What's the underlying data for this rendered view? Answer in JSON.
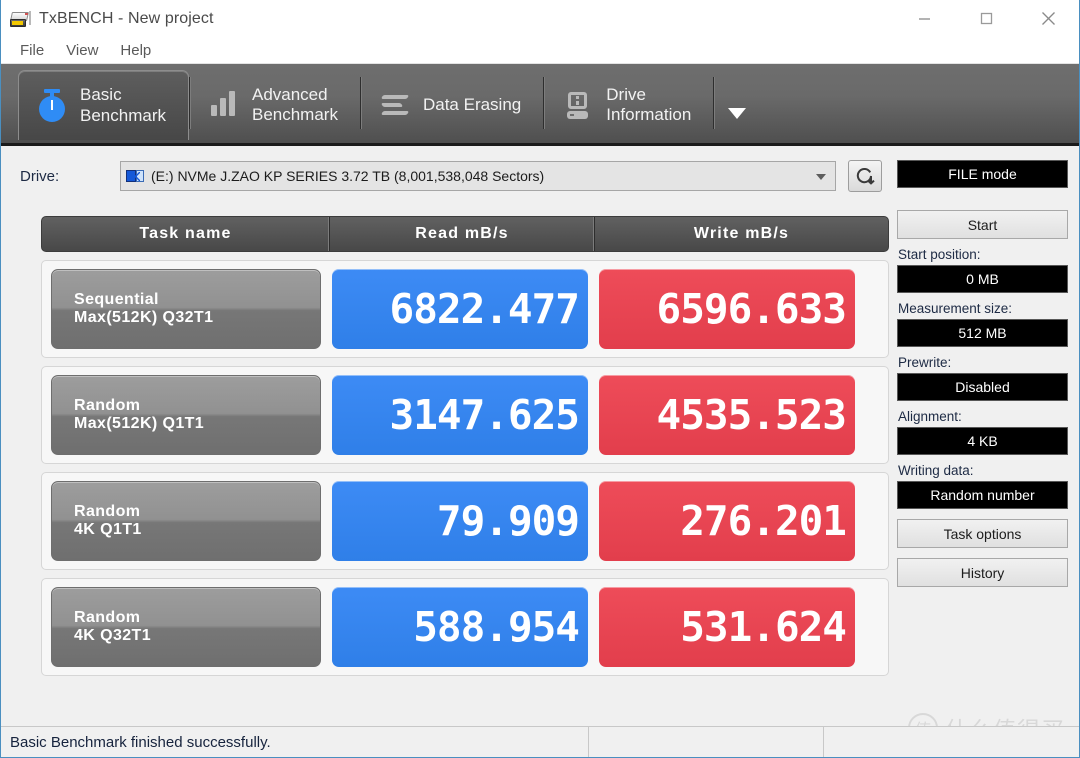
{
  "window": {
    "title": "TxBENCH - New project",
    "icon": "drive-app-icon",
    "controls": {
      "minimize": "minimize-icon",
      "maximize": "maximize-icon",
      "close": "close-icon"
    }
  },
  "menu": {
    "items": [
      "File",
      "View",
      "Help"
    ]
  },
  "tabs": {
    "items": [
      {
        "line1": "Basic",
        "line2": "Benchmark",
        "icon": "stopwatch-icon",
        "active": true
      },
      {
        "line1": "Advanced",
        "line2": "Benchmark",
        "icon": "bar-chart-icon",
        "active": false
      },
      {
        "line1": "Data Erasing",
        "line2": "",
        "icon": "erase-icon",
        "active": false
      },
      {
        "line1": "Drive",
        "line2": "Information",
        "icon": "drive-info-icon",
        "active": false
      }
    ],
    "more_icon": "chevron-down-icon"
  },
  "drive": {
    "label": "Drive:",
    "selected": "(E:) NVMe J.ZAO KP SERIES  3.72 TB (8,001,538,048 Sectors)",
    "icon": "network-drive-icon",
    "dropdown_icon": "chevron-down-icon",
    "refresh_icon": "refresh-icon"
  },
  "results": {
    "columns": [
      "Task name",
      "Read mB/s",
      "Write mB/s"
    ],
    "rows": [
      {
        "name_line1": "Sequential",
        "name_line2": "Max(512K) Q32T1",
        "read": "6822.477",
        "write": "6596.633"
      },
      {
        "name_line1": "Random",
        "name_line2": "Max(512K) Q1T1",
        "read": "3147.625",
        "write": "4535.523"
      },
      {
        "name_line1": "Random",
        "name_line2": "4K Q1T1",
        "read": "79.909",
        "write": "276.201"
      },
      {
        "name_line1": "Random",
        "name_line2": "4K Q32T1",
        "read": "588.954",
        "write": "531.624"
      }
    ]
  },
  "sidebar": {
    "mode_button": "FILE mode",
    "start_button": "Start",
    "fields": [
      {
        "label": "Start position:",
        "value": "0 MB"
      },
      {
        "label": "Measurement size:",
        "value": "512 MB"
      },
      {
        "label": "Prewrite:",
        "value": "Disabled"
      },
      {
        "label": "Alignment:",
        "value": "4 KB"
      },
      {
        "label": "Writing data:",
        "value": "Random number"
      }
    ],
    "task_options_button": "Task options",
    "history_button": "History"
  },
  "statusbar": {
    "message": "Basic Benchmark finished successfully.",
    "cell2": "",
    "cell3": ""
  },
  "watermark": {
    "mark": "值",
    "text": "什么值得买"
  },
  "colors": {
    "read_blue": "#3d8bf5",
    "write_red": "#ee4c59",
    "tab_strip": "#6a6a6a",
    "accent_blue": "#2f8cf5"
  }
}
